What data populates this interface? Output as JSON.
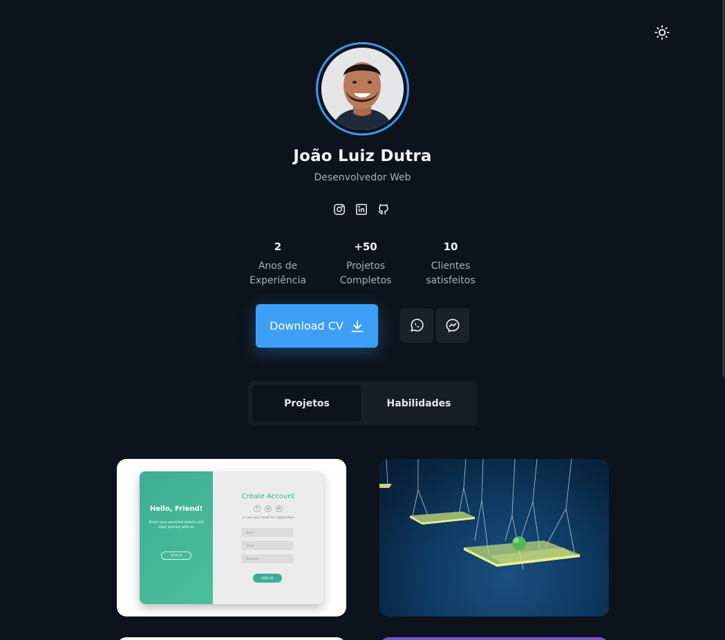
{
  "header": {
    "theme_toggle_icon": "sun-icon"
  },
  "profile": {
    "name": "João Luiz Dutra",
    "role": "Desenvolvedor Web",
    "socials": [
      {
        "icon": "instagram-icon"
      },
      {
        "icon": "linkedin-icon"
      },
      {
        "icon": "github-icon"
      }
    ]
  },
  "stats": [
    {
      "value": "2",
      "label_line1": "Anos de",
      "label_line2": "Experiência"
    },
    {
      "value": "+50",
      "label_line1": "Projetos",
      "label_line2": "Completos"
    },
    {
      "value": "10",
      "label_line1": "Clientes",
      "label_line2": "satisfeitos"
    }
  ],
  "actions": {
    "download_cv_label": "Download CV",
    "download_icon": "download-icon",
    "whatsapp_icon": "whatsapp-icon",
    "messenger_icon": "messenger-icon"
  },
  "tabs": [
    {
      "label": "Projetos",
      "active": true
    },
    {
      "label": "Habilidades",
      "active": false
    }
  ],
  "projects": {
    "card1": {
      "left_title": "Hello, Friend!",
      "left_text": "Enter your personal details and start journey with us",
      "left_button": "SIGN UP",
      "right_title": "Create Account",
      "social_f": "f",
      "social_g": "◎",
      "social_in": "in",
      "or_text": "or use your email for registration",
      "field_name": "Name",
      "field_email": "Email",
      "field_password": "Password",
      "submit": "SIGN UP"
    }
  },
  "colors": {
    "background": "#0d131c",
    "accent": "#3d9ff7",
    "panel": "#171d25"
  }
}
